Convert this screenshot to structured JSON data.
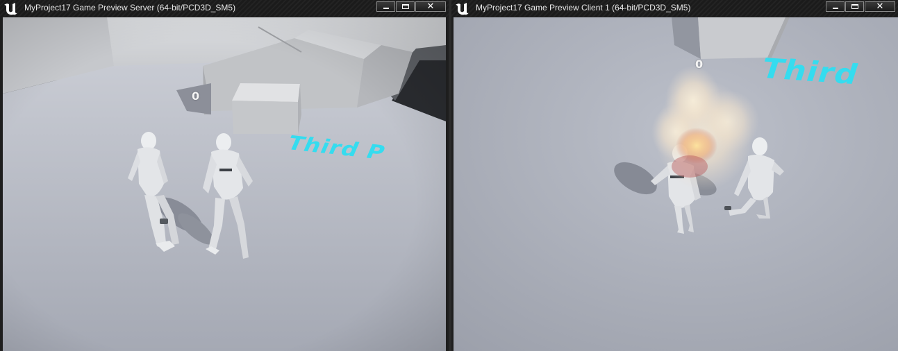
{
  "windows": {
    "server": {
      "title": "MyProject17 Game Preview Server (64-bit/PCD3D_SM5)",
      "score": "0",
      "floor_text": "Third P"
    },
    "client": {
      "title": "MyProject17 Game Preview Client 1 (64-bit/PCD3D_SM5)",
      "score": "0",
      "floor_text": "Third"
    }
  },
  "window_controls": {
    "minimize": "minimize-icon",
    "maximize": "maximize-icon",
    "close": "✕"
  },
  "colors": {
    "floor_text": "#35dcef",
    "floor": "#a9adb8",
    "titlebar": "#1b1b1b"
  }
}
